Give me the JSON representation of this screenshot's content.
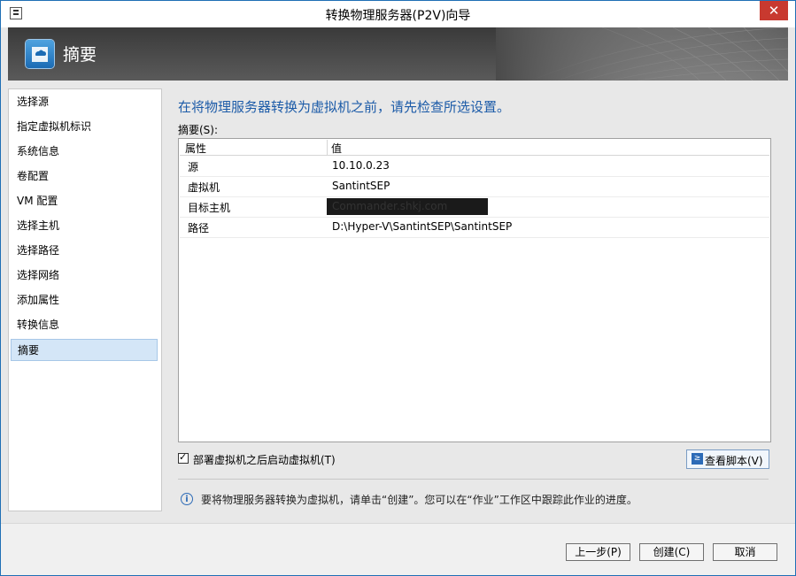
{
  "window": {
    "title": "转换物理服务器(P2V)向导",
    "close_glyph": "✕"
  },
  "banner": {
    "title": "摘要"
  },
  "nav": {
    "items": [
      {
        "label": "选择源"
      },
      {
        "label": "指定虚拟机标识"
      },
      {
        "label": "系统信息"
      },
      {
        "label": "卷配置"
      },
      {
        "label": "VM 配置"
      },
      {
        "label": "选择主机"
      },
      {
        "label": "选择路径"
      },
      {
        "label": "选择网络"
      },
      {
        "label": "添加属性"
      },
      {
        "label": "转换信息"
      },
      {
        "label": "摘要"
      }
    ],
    "active_index": 10
  },
  "main": {
    "heading": "在将物理服务器转换为虚拟机之前，请先检查所选设置。",
    "summary_label": "摘要(S):",
    "table": {
      "columns": [
        "属性",
        "值"
      ],
      "rows": [
        {
          "property": "源",
          "value": "10.10.0.23"
        },
        {
          "property": "虚拟机",
          "value": "SantintSEP"
        },
        {
          "property": "目标主机",
          "value": "Commander.shkj.com"
        },
        {
          "property": "路径",
          "value": "D:\\Hyper-V\\SantintSEP\\SantintSEP"
        }
      ]
    },
    "start_vm_checkbox": {
      "label": "部署虚拟机之后启动虚拟机(T)",
      "checked": true
    },
    "view_script_button": "查看脚本(V)",
    "info_text": "要将物理服务器转换为虚拟机，请单击“创建”。您可以在“作业”工作区中跟踪此作业的进度。"
  },
  "footer": {
    "back_label": "上一步(P)",
    "create_label": "创建(C)",
    "cancel_label": "取消"
  },
  "colors": {
    "accent": "#1c5ba8",
    "nav_active_bg": "#d4e6f7",
    "close_button": "#c8392f"
  },
  "icons": {
    "app": "app-window-icon",
    "banner": "summary-cloud-icon",
    "script": "powershell-script-icon",
    "info": "info-icon"
  }
}
